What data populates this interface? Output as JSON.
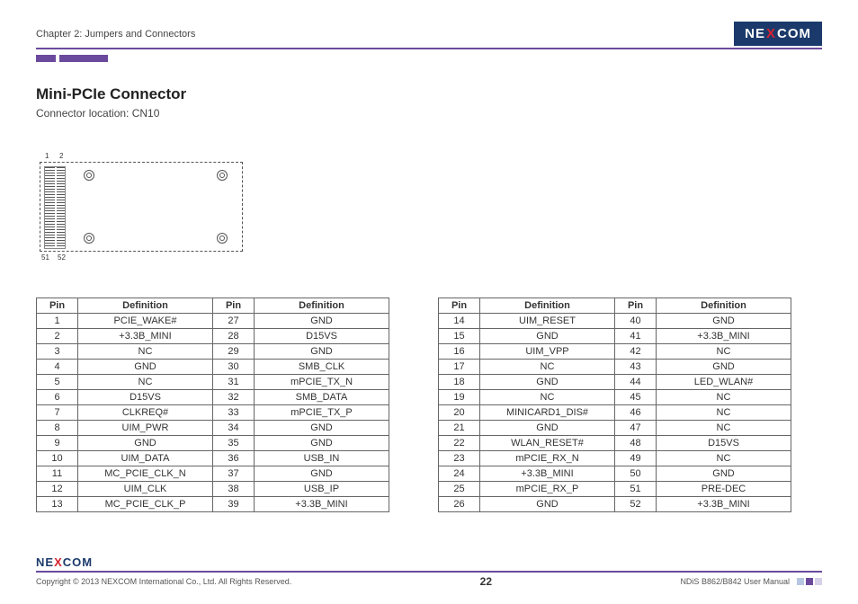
{
  "header": {
    "chapter": "Chapter 2: Jumpers and Connectors",
    "logo_parts": {
      "pre": "NE",
      "x": "X",
      "post": "COM"
    }
  },
  "section": {
    "title": "Mini-PCIe Connector",
    "subtitle": "Connector location: CN10"
  },
  "diagram_labels": {
    "top_left": "1",
    "top_right": "2",
    "bot_left": "51",
    "bot_right": "52"
  },
  "table_headers": {
    "pin": "Pin",
    "definition": "Definition"
  },
  "table_left": [
    {
      "p1": "1",
      "d1": "PCIE_WAKE#",
      "p2": "27",
      "d2": "GND"
    },
    {
      "p1": "2",
      "d1": "+3.3B_MINI",
      "p2": "28",
      "d2": "D15VS"
    },
    {
      "p1": "3",
      "d1": "NC",
      "p2": "29",
      "d2": "GND"
    },
    {
      "p1": "4",
      "d1": "GND",
      "p2": "30",
      "d2": "SMB_CLK"
    },
    {
      "p1": "5",
      "d1": "NC",
      "p2": "31",
      "d2": "mPCIE_TX_N"
    },
    {
      "p1": "6",
      "d1": "D15VS",
      "p2": "32",
      "d2": "SMB_DATA"
    },
    {
      "p1": "7",
      "d1": "CLKREQ#",
      "p2": "33",
      "d2": "mPCIE_TX_P"
    },
    {
      "p1": "8",
      "d1": "UIM_PWR",
      "p2": "34",
      "d2": "GND"
    },
    {
      "p1": "9",
      "d1": "GND",
      "p2": "35",
      "d2": "GND"
    },
    {
      "p1": "10",
      "d1": "UIM_DATA",
      "p2": "36",
      "d2": "USB_IN"
    },
    {
      "p1": "11",
      "d1": "MC_PCIE_CLK_N",
      "p2": "37",
      "d2": "GND"
    },
    {
      "p1": "12",
      "d1": "UIM_CLK",
      "p2": "38",
      "d2": "USB_IP"
    },
    {
      "p1": "13",
      "d1": "MC_PCIE_CLK_P",
      "p2": "39",
      "d2": "+3.3B_MINI"
    }
  ],
  "table_right": [
    {
      "p1": "14",
      "d1": "UIM_RESET",
      "p2": "40",
      "d2": "GND"
    },
    {
      "p1": "15",
      "d1": "GND",
      "p2": "41",
      "d2": "+3.3B_MINI"
    },
    {
      "p1": "16",
      "d1": "UIM_VPP",
      "p2": "42",
      "d2": "NC"
    },
    {
      "p1": "17",
      "d1": "NC",
      "p2": "43",
      "d2": "GND"
    },
    {
      "p1": "18",
      "d1": "GND",
      "p2": "44",
      "d2": "LED_WLAN#"
    },
    {
      "p1": "19",
      "d1": "NC",
      "p2": "45",
      "d2": "NC"
    },
    {
      "p1": "20",
      "d1": "MINICARD1_DIS#",
      "p2": "46",
      "d2": "NC"
    },
    {
      "p1": "21",
      "d1": "GND",
      "p2": "47",
      "d2": "NC"
    },
    {
      "p1": "22",
      "d1": "WLAN_RESET#",
      "p2": "48",
      "d2": "D15VS"
    },
    {
      "p1": "23",
      "d1": "mPCIE_RX_N",
      "p2": "49",
      "d2": "NC"
    },
    {
      "p1": "24",
      "d1": "+3.3B_MINI",
      "p2": "50",
      "d2": "GND"
    },
    {
      "p1": "25",
      "d1": "mPCIE_RX_P",
      "p2": "51",
      "d2": "PRE-DEC"
    },
    {
      "p1": "26",
      "d1": "GND",
      "p2": "52",
      "d2": "+3.3B_MINI"
    }
  ],
  "footer": {
    "copyright": "Copyright © 2013 NEXCOM International Co., Ltd. All Rights Reserved.",
    "page": "22",
    "doc": "NDiS B862/B842 User Manual"
  }
}
